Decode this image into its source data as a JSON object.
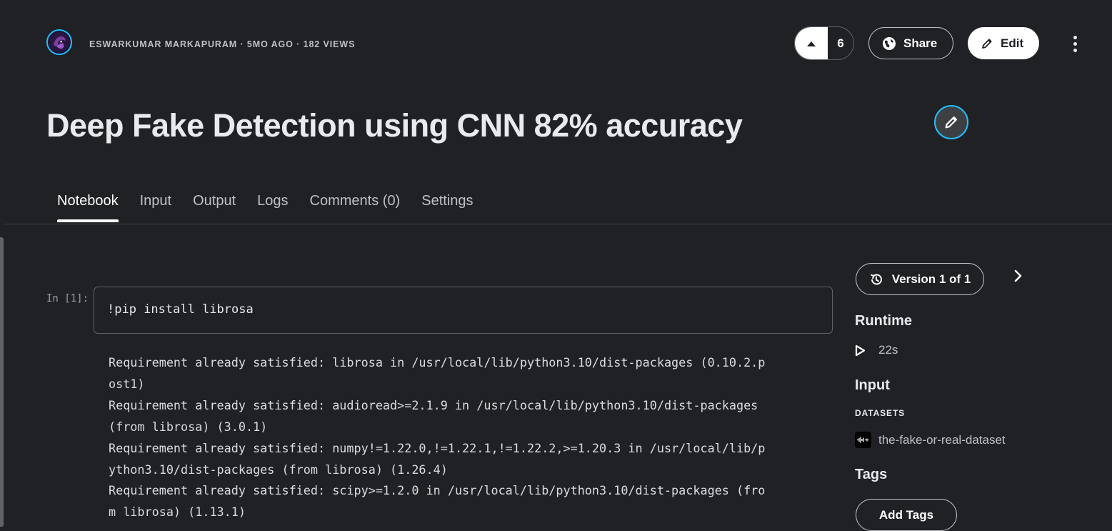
{
  "header": {
    "author": "ESWARKUMAR MARKAPURAM",
    "separator": " · ",
    "age": "5MO AGO",
    "views": "182 VIEWS",
    "upvote_count": "6",
    "share_label": "Share",
    "edit_label": "Edit"
  },
  "title": "Deep Fake Detection using CNN 82% accuracy",
  "tabs": [
    {
      "label": "Notebook",
      "active": true
    },
    {
      "label": "Input"
    },
    {
      "label": "Output"
    },
    {
      "label": "Logs"
    },
    {
      "label": "Comments (0)"
    },
    {
      "label": "Settings"
    }
  ],
  "notebook": {
    "prompt": "In [1]:",
    "code": "!pip install librosa",
    "output_lines": [
      "Requirement already satisfied: librosa in /usr/local/lib/python3.10/dist-packages (0.10.2.p",
      "ost1)",
      "Requirement already satisfied: audioread>=2.1.9 in /usr/local/lib/python3.10/dist-packages",
      "(from librosa) (3.0.1)",
      "Requirement already satisfied: numpy!=1.22.0,!=1.22.1,!=1.22.2,>=1.20.3 in /usr/local/lib/p",
      "ython3.10/dist-packages (from librosa) (1.26.4)",
      "Requirement already satisfied: scipy>=1.2.0 in /usr/local/lib/python3.10/dist-packages (fro",
      "m librosa) (1.13.1)"
    ]
  },
  "sidebar": {
    "version_label": "Version 1 of 1",
    "runtime_heading": "Runtime",
    "runtime_value": "22s",
    "input_heading": "Input",
    "datasets_label": "DATASETS",
    "dataset_name": "the-fake-or-real-dataset",
    "tags_heading": "Tags",
    "add_tags_label": "Add Tags"
  },
  "colors": {
    "background": "#202124",
    "accent": "#20beff",
    "text": "#e8eaed"
  },
  "icons": [
    "avatar",
    "upvote-arrow-icon",
    "globe-icon",
    "pencil-icon",
    "more-vert-icon",
    "history-icon",
    "chevron-right-icon",
    "play-icon",
    "dataset-waveform-icon"
  ]
}
